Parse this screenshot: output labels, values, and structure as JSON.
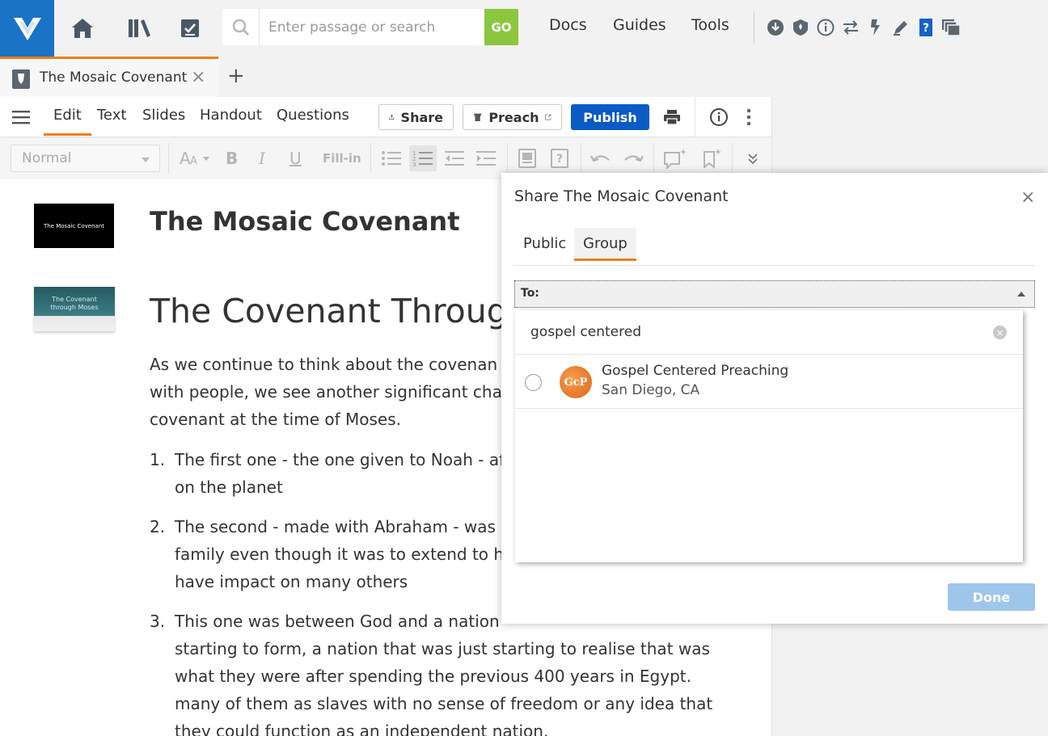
{
  "colors": {
    "brand_blue": "#1a73c7",
    "accent_orange": "#f07d18",
    "go_green": "#8cc63f",
    "publish_blue": "#0a5bc4",
    "done_disabled_blue": "#9ec6ec"
  },
  "topbar": {
    "logo_icon": "logos-logo-icon",
    "search": {
      "placeholder": "Enter passage or search",
      "value": "",
      "go_label": "GO"
    },
    "nav": [
      "Docs",
      "Guides",
      "Tools"
    ],
    "tool_icons": [
      "download-icon",
      "shield-icon",
      "info-icon",
      "swap-arrows-icon",
      "flash-icon",
      "pen-icon",
      "help-book-icon",
      "windows-icon"
    ]
  },
  "tabs": {
    "active_title": "The Mosaic Covenant",
    "add_label": "+"
  },
  "editor_toolbar": {
    "modes": [
      "Edit",
      "Text",
      "Slides",
      "Handout",
      "Questions"
    ],
    "active_mode": "Edit",
    "share_label": "Share",
    "preach_label": "Preach",
    "publish_label": "Publish"
  },
  "format_bar": {
    "style_value": "Normal",
    "fill_in_label": "Fill-in"
  },
  "document": {
    "slide1_text": "The Mosaic Covenant",
    "slide2_line1": "The Covenant",
    "slide2_line2": "through Moses",
    "title": "The Mosaic Covenant",
    "heading": "The Covenant Through",
    "paragraph_lines": [
      "As we continue to think about the covenan",
      "with people, we see another significant cha",
      "covenant at the time of Moses."
    ],
    "list": [
      {
        "num": "1.",
        "lines": [
          "The first one - the one given to Noah - af",
          "on the planet"
        ]
      },
      {
        "num": "2.",
        "lines": [
          "The second - made with Abraham - was",
          "family even though it was to extend to h",
          "have impact on many others"
        ]
      },
      {
        "num": "3.",
        "lines": [
          "This one was between God and a nation",
          "starting to form, a nation that was just starting to realise that was",
          "what they were after spending the previous 400 years in Egypt.",
          "many of them as slaves with no sense of freedom or any idea that",
          "they could function as an independent nation."
        ]
      }
    ]
  },
  "share_dialog": {
    "title": "Share The Mosaic Covenant",
    "close_label": "×",
    "tabs": [
      "Public",
      "Group"
    ],
    "active_tab": "Group",
    "to_label": "To:",
    "search_value": "gospel centered",
    "results": [
      {
        "avatar_text": "GcP",
        "name": "Gospel Centered Preaching",
        "location": "San Diego, CA"
      }
    ],
    "done_label": "Done"
  }
}
